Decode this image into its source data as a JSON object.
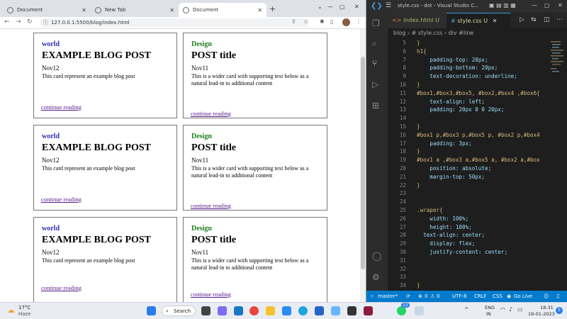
{
  "browser": {
    "tabs": [
      {
        "label": "Document",
        "active": false
      },
      {
        "label": "New Tab",
        "active": false
      },
      {
        "label": "Document",
        "active": true
      }
    ],
    "new_tab_icon": "+",
    "url": "127.0.0.1:5500/blog/index.html",
    "cards": [
      {
        "category": "world",
        "title": "EXAMPLE BLOG POST",
        "date": "Nov12",
        "text": "This card represent an example blog post",
        "link": "continue reading"
      },
      {
        "category": "Design",
        "title": "POST title",
        "date": "Nov11",
        "text": "This is a wider card with supporting text below as a natural lead-in to additional content",
        "link": "continue reading"
      },
      {
        "category": "world",
        "title": "EXAMPLE BLOG POST",
        "date": "Nov12",
        "text": "This card represent an example blog post",
        "link": "continue reading"
      },
      {
        "category": "Design",
        "title": "POST title",
        "date": "Nov11",
        "text": "This is a wider card with supporting text below as a natural lead-in to additional content",
        "link": "continue reading"
      },
      {
        "category": "world",
        "title": "EXAMPLE BLOG POST",
        "date": "Nov12",
        "text": "This card represent an example blog post",
        "link": "continue reading"
      },
      {
        "category": "Design",
        "title": "POST title",
        "date": "Nov11",
        "text": "This is a wider card with supporting text below as a natural lead-in to additional content",
        "link": "continue reading"
      }
    ]
  },
  "vscode": {
    "window_title": "style.css - dot - Visual Studio C...",
    "tabs": [
      {
        "label": "index.html",
        "status": "U",
        "active": false
      },
      {
        "label": "style.css",
        "status": "U",
        "active": true
      }
    ],
    "breadcrumbs": [
      "blog",
      "#  style.css",
      "div #line"
    ],
    "lines": [
      {
        "n": "5",
        "code": "}"
      },
      {
        "n": "6",
        "code": "h1{"
      },
      {
        "n": "7",
        "code": "    padding-top: 20px;"
      },
      {
        "n": "8",
        "code": "    padding-bottom: 20px;"
      },
      {
        "n": "9",
        "code": "    text-decoration: underline;"
      },
      {
        "n": "10",
        "code": "}"
      },
      {
        "n": "11",
        "code": "#box1,#box3,#box5, #box2,#box4 ,#box6{"
      },
      {
        "n": "12",
        "code": "    text-align: left;"
      },
      {
        "n": "13",
        "code": "    padding: 20px 0 0 20px;"
      },
      {
        "n": "14",
        "code": ""
      },
      {
        "n": "15",
        "code": "}"
      },
      {
        "n": "16",
        "code": "#box1 p,#box3 p,#box5 p, #box2 p,#box4"
      },
      {
        "n": "17",
        "code": "    padding: 3px;"
      },
      {
        "n": "18",
        "code": "}"
      },
      {
        "n": "19",
        "code": "#box1 a ,#box3 a,#box5 a, #box2 a,#box"
      },
      {
        "n": "20",
        "code": "    position: absolute;"
      },
      {
        "n": "21",
        "code": "    margin-top: 50px;"
      },
      {
        "n": "22",
        "code": "}"
      },
      {
        "n": "23",
        "code": ""
      },
      {
        "n": "24",
        "code": ""
      },
      {
        "n": "25",
        "code": ".wraper{"
      },
      {
        "n": "26",
        "code": "    width: 100%;"
      },
      {
        "n": "27",
        "code": "    height: 100%;"
      },
      {
        "n": "28",
        "code": "  text-align: center;"
      },
      {
        "n": "29",
        "code": "    display: flex;"
      },
      {
        "n": "30",
        "code": "    justify-content: center;"
      },
      {
        "n": "31",
        "code": ""
      },
      {
        "n": "32",
        "code": ""
      },
      {
        "n": "33",
        "code": ""
      },
      {
        "n": "34",
        "code": "}"
      }
    ],
    "status": {
      "branch": "master*",
      "errors": "0",
      "warnings": "0",
      "encoding": "UTF-8",
      "eol": "CRLF",
      "language": "CSS",
      "live": "Go Live"
    }
  },
  "taskbar": {
    "weather_temp": "17°C",
    "weather_desc": "Haze",
    "search_label": "Search",
    "whatsapp_badge": "12",
    "lang": "ENG",
    "region": "IN",
    "time": "18:31",
    "date": "19-01-2023",
    "notif_count": "5"
  },
  "colors": {
    "vscode_status": "#007acc",
    "selector": "#d7ba7d",
    "property": "#9cdcfe",
    "value": "#ce9178",
    "tag": "#569cd6",
    "world": "#2b2fae",
    "design": "#1b7f1b",
    "link": "#551a8b"
  }
}
